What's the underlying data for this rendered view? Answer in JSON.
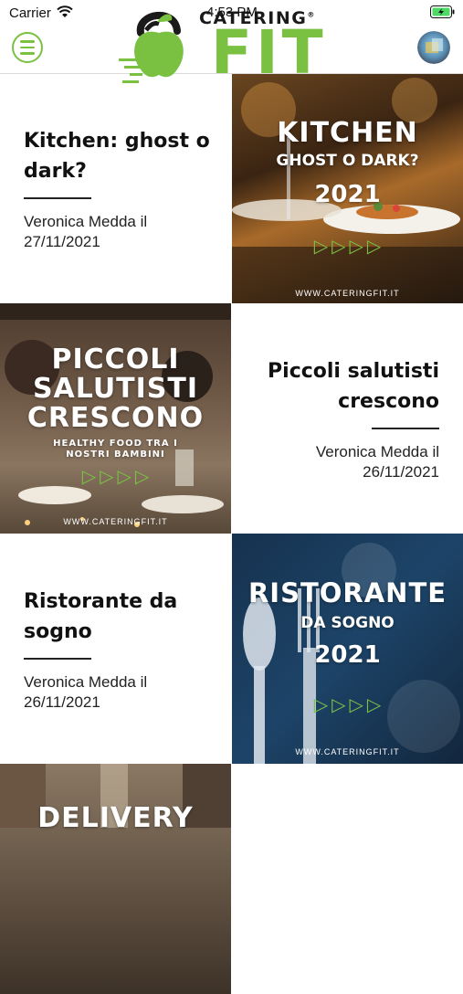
{
  "status": {
    "carrier": "Carrier",
    "time": "4:53 PM"
  },
  "header": {
    "logo_top": "CATERING",
    "logo_main": "FIT",
    "logo_reg": "®"
  },
  "posts": [
    {
      "title": "Kitchen: ghost o dark?",
      "meta": "Veronica Medda il 27/11/2021",
      "image": {
        "line1": "KITCHEN",
        "line2": "GHOST O DARK?",
        "line3": "2021",
        "site": "WWW.CATERINGFIT.IT"
      }
    },
    {
      "title": "Piccoli salutisti crescono",
      "meta": "Veronica Medda il 26/11/2021",
      "image": {
        "line1": "PICCOLI",
        "line2": "SALUTISTI",
        "line3": "CRESCONO",
        "sub1": "HEALTHY FOOD TRA I",
        "sub2": "NOSTRI BAMBINI",
        "site": "WWW.CATERINGFIT.IT"
      }
    },
    {
      "title": "Ristorante da sogno",
      "meta": "Veronica Medda il 26/11/2021",
      "image": {
        "line1": "RISTORANTE",
        "line2": "DA SOGNO",
        "line3": "2021",
        "site": "WWW.CATERINGFIT.IT"
      }
    },
    {
      "image": {
        "line1": "DELIVERY"
      }
    }
  ]
}
